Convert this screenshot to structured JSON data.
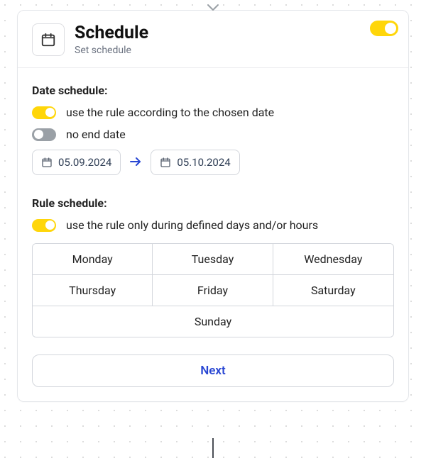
{
  "header": {
    "title": "Schedule",
    "subtitle": "Set schedule",
    "enabled": true
  },
  "date_schedule": {
    "label": "Date schedule:",
    "use_rule_toggle": {
      "on": true,
      "text": "use the rule according to the chosen date"
    },
    "no_end_toggle": {
      "on": false,
      "text": "no end date"
    },
    "start_date": "05.09.2024",
    "end_date": "05.10.2024"
  },
  "rule_schedule": {
    "label": "Rule schedule:",
    "defined_days_toggle": {
      "on": true,
      "text": "use the rule only during defined days and/or hours"
    },
    "days": [
      "Monday",
      "Tuesday",
      "Wednesday",
      "Thursday",
      "Friday",
      "Saturday",
      "Sunday"
    ]
  },
  "next_label": "Next"
}
